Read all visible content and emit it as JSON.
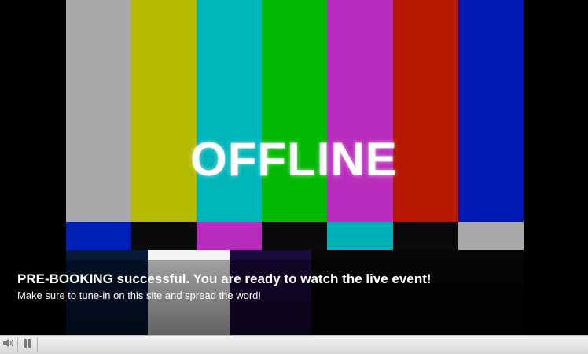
{
  "video": {
    "overlay_text": "OFFLINE"
  },
  "notice": {
    "headline": "PRE-BOOKING successful. You are ready to watch the live event!",
    "subline": "Make sure to tune-in on this site and spread the word!"
  },
  "controls": {
    "volume_icon": "speaker-icon",
    "pause_icon": "pause-icon"
  },
  "colors": {
    "control_bar": "#e6e6e6",
    "icon": "#7a7a7a"
  }
}
